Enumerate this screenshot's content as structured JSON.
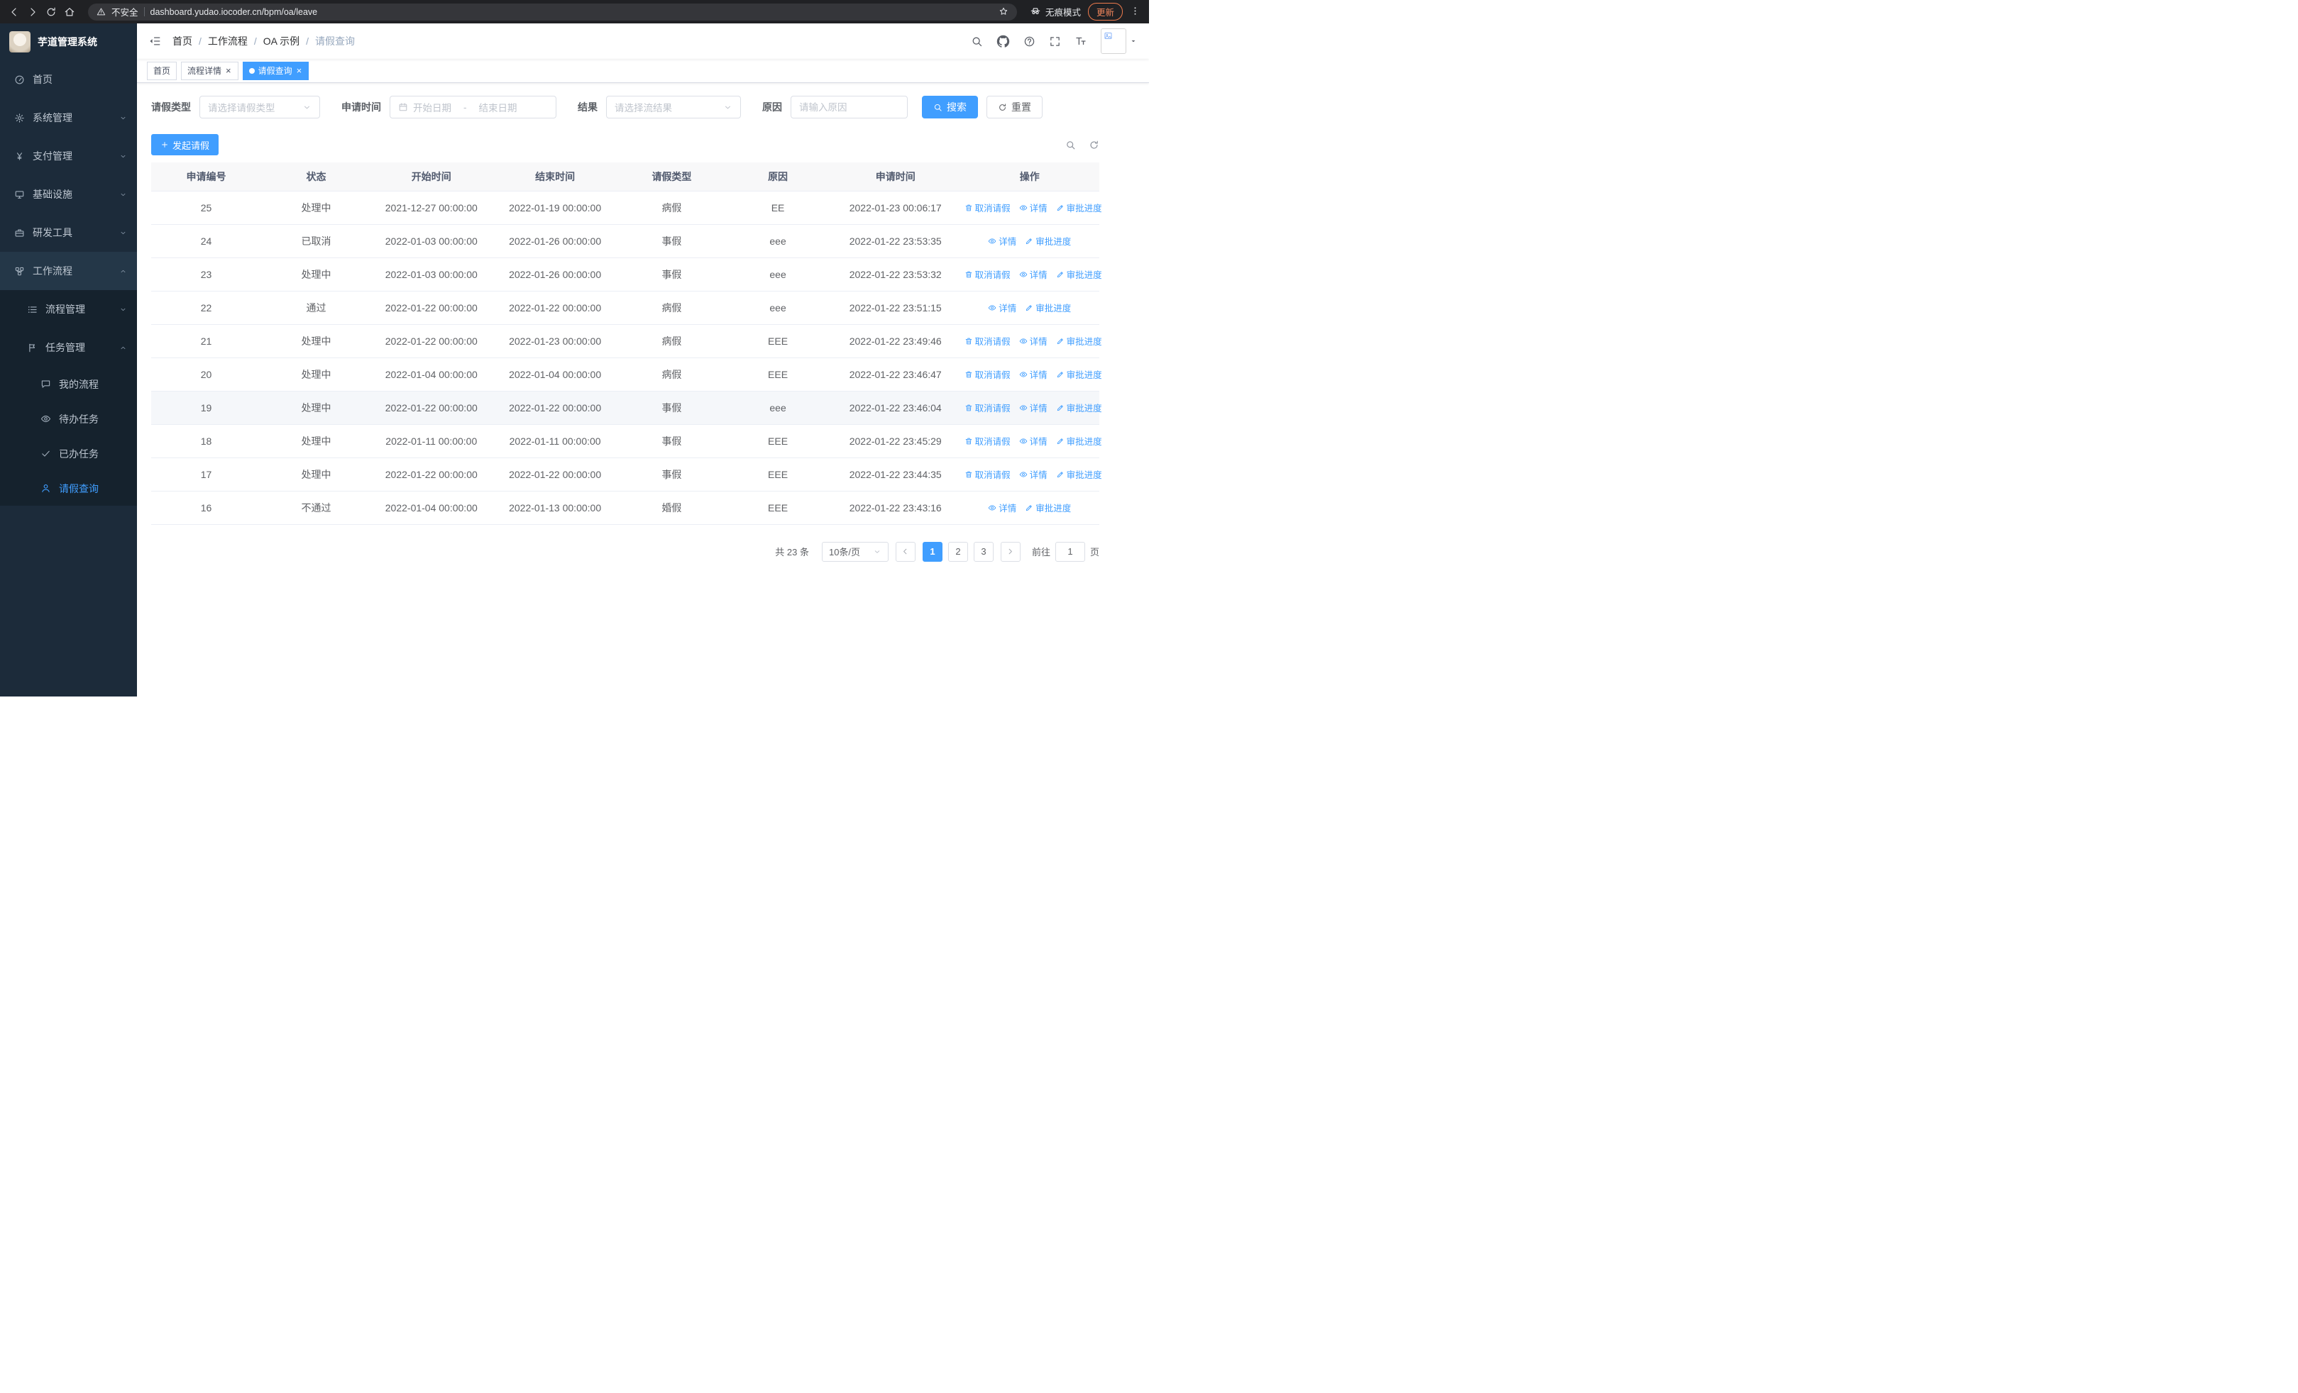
{
  "browser": {
    "security_label": "不安全",
    "url": "dashboard.yudao.iocoder.cn/bpm/oa/leave",
    "incognito_label": "无痕模式",
    "update_label": "更新"
  },
  "sidebar": {
    "app_title": "芋道管理系统",
    "menu": [
      {
        "key": "home",
        "label": "首页",
        "icon": "gauge",
        "level": 0
      },
      {
        "key": "system",
        "label": "系统管理",
        "icon": "gear",
        "level": 0,
        "chevron": "down"
      },
      {
        "key": "payment",
        "label": "支付管理",
        "icon": "yen",
        "level": 0,
        "chevron": "down"
      },
      {
        "key": "infra",
        "label": "基础设施",
        "icon": "infra",
        "level": 0,
        "chevron": "down"
      },
      {
        "key": "devtools",
        "label": "研发工具",
        "icon": "tools",
        "level": 0,
        "chevron": "down"
      },
      {
        "key": "workflow",
        "label": "工作流程",
        "icon": "workflow",
        "level": 0,
        "chevron": "up",
        "open": true
      },
      {
        "key": "process-mgmt",
        "label": "流程管理",
        "icon": "process",
        "level": 1,
        "chevron": "down"
      },
      {
        "key": "task-mgmt",
        "label": "任务管理",
        "icon": "task",
        "level": 1,
        "chevron": "up",
        "open": true
      },
      {
        "key": "my-process",
        "label": "我的流程",
        "icon": "chat",
        "level": 2
      },
      {
        "key": "todo-tasks",
        "label": "待办任务",
        "icon": "view",
        "level": 2
      },
      {
        "key": "done-tasks",
        "label": "已办任务",
        "icon": "done",
        "level": 2
      },
      {
        "key": "leave-query",
        "label": "请假查询",
        "icon": "user",
        "level": 2,
        "active": true
      }
    ]
  },
  "navbar": {
    "breadcrumb": [
      {
        "key": "home",
        "label": "首页"
      },
      {
        "key": "workflow",
        "label": "工作流程"
      },
      {
        "key": "oa-example",
        "label": "OA 示例"
      },
      {
        "key": "leave-query",
        "label": "请假查询",
        "current": true
      }
    ]
  },
  "tabs": [
    {
      "key": "home",
      "label": "首页"
    },
    {
      "key": "process-detail",
      "label": "流程详情",
      "closable": true
    },
    {
      "key": "leave-query",
      "label": "请假查询",
      "closable": true,
      "active": true
    }
  ],
  "filters": {
    "leave_type": {
      "label": "请假类型",
      "placeholder": "请选择请假类型"
    },
    "apply_time": {
      "label": "申请时间",
      "start_placeholder": "开始日期",
      "separator": "-",
      "end_placeholder": "结束日期"
    },
    "result": {
      "label": "结果",
      "placeholder": "请选择流结果"
    },
    "reason": {
      "label": "原因",
      "placeholder": "请输入原因"
    },
    "search_label": "搜索",
    "reset_label": "重置"
  },
  "toolbar": {
    "create_label": "发起请假"
  },
  "table": {
    "columns": [
      "申请编号",
      "状态",
      "开始时间",
      "结束时间",
      "请假类型",
      "原因",
      "申请时间",
      "操作"
    ],
    "action_labels": {
      "cancel": "取消请假",
      "detail": "详情",
      "progress": "审批进度"
    },
    "rows": [
      {
        "id": "25",
        "status": "处理中",
        "start": "2021-12-27 00:00:00",
        "end": "2022-01-19 00:00:00",
        "type": "病假",
        "reason": "EE",
        "apply_time": "2022-01-23 00:06:17",
        "actions": [
          "cancel",
          "detail",
          "progress"
        ]
      },
      {
        "id": "24",
        "status": "已取消",
        "start": "2022-01-03 00:00:00",
        "end": "2022-01-26 00:00:00",
        "type": "事假",
        "reason": "eee",
        "apply_time": "2022-01-22 23:53:35",
        "actions": [
          "detail",
          "progress"
        ]
      },
      {
        "id": "23",
        "status": "处理中",
        "start": "2022-01-03 00:00:00",
        "end": "2022-01-26 00:00:00",
        "type": "事假",
        "reason": "eee",
        "apply_time": "2022-01-22 23:53:32",
        "actions": [
          "cancel",
          "detail",
          "progress"
        ]
      },
      {
        "id": "22",
        "status": "通过",
        "start": "2022-01-22 00:00:00",
        "end": "2022-01-22 00:00:00",
        "type": "病假",
        "reason": "eee",
        "apply_time": "2022-01-22 23:51:15",
        "actions": [
          "detail",
          "progress"
        ]
      },
      {
        "id": "21",
        "status": "处理中",
        "start": "2022-01-22 00:00:00",
        "end": "2022-01-23 00:00:00",
        "type": "病假",
        "reason": "EEE",
        "apply_time": "2022-01-22 23:49:46",
        "actions": [
          "cancel",
          "detail",
          "progress"
        ]
      },
      {
        "id": "20",
        "status": "处理中",
        "start": "2022-01-04 00:00:00",
        "end": "2022-01-04 00:00:00",
        "type": "病假",
        "reason": "EEE",
        "apply_time": "2022-01-22 23:46:47",
        "actions": [
          "cancel",
          "detail",
          "progress"
        ]
      },
      {
        "id": "19",
        "status": "处理中",
        "start": "2022-01-22 00:00:00",
        "end": "2022-01-22 00:00:00",
        "type": "事假",
        "reason": "eee",
        "apply_time": "2022-01-22 23:46:04",
        "actions": [
          "cancel",
          "detail",
          "progress"
        ],
        "highlighted": true
      },
      {
        "id": "18",
        "status": "处理中",
        "start": "2022-01-11 00:00:00",
        "end": "2022-01-11 00:00:00",
        "type": "事假",
        "reason": "EEE",
        "apply_time": "2022-01-22 23:45:29",
        "actions": [
          "cancel",
          "detail",
          "progress"
        ]
      },
      {
        "id": "17",
        "status": "处理中",
        "start": "2022-01-22 00:00:00",
        "end": "2022-01-22 00:00:00",
        "type": "事假",
        "reason": "EEE",
        "apply_time": "2022-01-22 23:44:35",
        "actions": [
          "cancel",
          "detail",
          "progress"
        ]
      },
      {
        "id": "16",
        "status": "不通过",
        "start": "2022-01-04 00:00:00",
        "end": "2022-01-13 00:00:00",
        "type": "婚假",
        "reason": "EEE",
        "apply_time": "2022-01-22 23:43:16",
        "actions": [
          "detail",
          "progress"
        ]
      }
    ]
  },
  "pagination": {
    "total_label": "共 23 条",
    "page_size_label": "10条/页",
    "pages": [
      "1",
      "2",
      "3"
    ],
    "active_page": "1",
    "goto_prefix": "前往",
    "goto_value": "1",
    "goto_suffix": "页"
  },
  "colors": {
    "accent": "#409eff",
    "sidebar_bg": "#1c2b3a",
    "sidebar_sub_bg": "#15222d"
  }
}
